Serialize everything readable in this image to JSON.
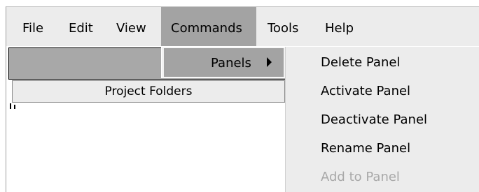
{
  "menubar": {
    "items": [
      {
        "label": "File"
      },
      {
        "label": "Edit"
      },
      {
        "label": "View"
      },
      {
        "label": "Commands"
      },
      {
        "label": "Tools"
      },
      {
        "label": "Help"
      }
    ]
  },
  "panel": {
    "header_label": "Project Folders"
  },
  "commands_menu": {
    "panels_label": "Panels",
    "panels_submenu": [
      {
        "label": "Delete Panel",
        "enabled": true
      },
      {
        "label": "Activate Panel",
        "enabled": true
      },
      {
        "label": "Deactivate Panel",
        "enabled": true
      },
      {
        "label": "Rename Panel",
        "enabled": true
      },
      {
        "label": "Add to Panel",
        "enabled": false
      }
    ]
  }
}
